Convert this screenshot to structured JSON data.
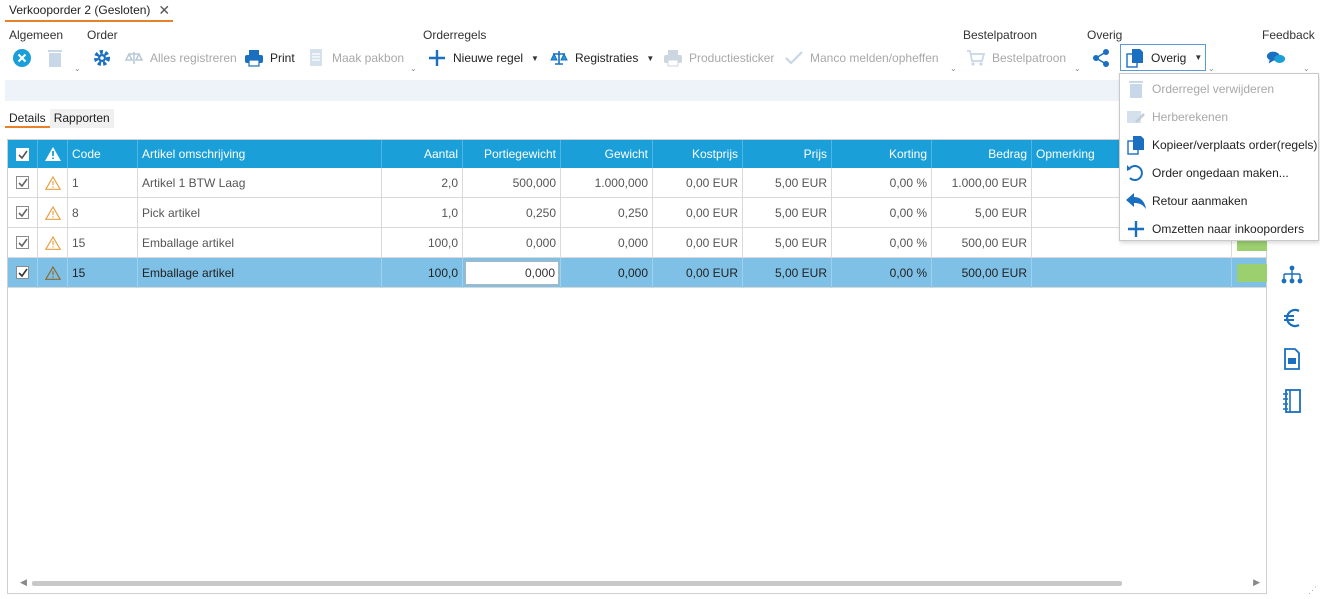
{
  "document_tab": {
    "title": "Verkooporder 2 (Gesloten)",
    "close_icon": "close-icon"
  },
  "ribbon": {
    "groups": {
      "algemeen": "Algemeen",
      "order": "Order",
      "orderregels": "Orderregels",
      "bestelpatroon": "Bestelpatroon",
      "overig": "Overig",
      "feedback": "Feedback"
    },
    "buttons": {
      "alles_registreren": "Alles registreren",
      "print": "Print",
      "maak_pakbon": "Maak pakbon",
      "nieuwe_regel": "Nieuwe regel",
      "registraties": "Registraties",
      "productiesticker": "Productiesticker",
      "manco": "Manco melden/opheffen",
      "bestelpatroon": "Bestelpatroon",
      "overig": "Overig"
    }
  },
  "subtabs": [
    {
      "label": "Details",
      "active": true
    },
    {
      "label": "Rapporten",
      "active": false
    }
  ],
  "grid": {
    "columns": [
      "Code",
      "Artikel omschrijving",
      "Aantal",
      "Portiegewicht",
      "Gewicht",
      "Kostprijs",
      "Prijs",
      "Korting",
      "Bedrag",
      "Opmerking"
    ],
    "rows": [
      {
        "code": "1",
        "omschrijving": "Artikel 1 BTW Laag",
        "aantal": "2,0",
        "portiegewicht": "500,000",
        "gewicht": "1.000,000",
        "kostprijs": "0,00 EUR",
        "prijs": "5,00 EUR",
        "korting": "0,00 %",
        "bedrag": "1.000,00 EUR",
        "opmerking": "",
        "selected": false
      },
      {
        "code": "8",
        "omschrijving": "Pick artikel",
        "aantal": "1,0",
        "portiegewicht": "0,250",
        "gewicht": "0,250",
        "kostprijs": "0,00 EUR",
        "prijs": "5,00 EUR",
        "korting": "0,00 %",
        "bedrag": "5,00 EUR",
        "opmerking": "",
        "selected": false
      },
      {
        "code": "15",
        "omschrijving": "Emballage artikel",
        "aantal": "100,0",
        "portiegewicht": "0,000",
        "gewicht": "0,000",
        "kostprijs": "0,00 EUR",
        "prijs": "5,00 EUR",
        "korting": "0,00 %",
        "bedrag": "500,00 EUR",
        "opmerking": "",
        "selected": false
      },
      {
        "code": "15",
        "omschrijving": "Emballage artikel",
        "aantal": "100,0",
        "portiegewicht": "0,000",
        "gewicht": "0,000",
        "kostprijs": "0,00 EUR",
        "prijs": "5,00 EUR",
        "korting": "0,00 %",
        "bedrag": "500,00 EUR",
        "opmerking": "",
        "selected": true
      }
    ]
  },
  "overig_menu": {
    "items": [
      {
        "label": "Orderregel verwijderen",
        "icon": "trash-icon",
        "disabled": true
      },
      {
        "label": "Herberekenen",
        "icon": "recalculate-icon",
        "disabled": true
      },
      {
        "label": "Kopieer/verplaats order(regels)",
        "icon": "copy-icon",
        "disabled": false
      },
      {
        "label": "Order ongedaan maken...",
        "icon": "undo-icon",
        "disabled": false
      },
      {
        "label": "Retour aanmaken",
        "icon": "return-icon",
        "disabled": false
      },
      {
        "label": "Omzetten naar inkooporders",
        "icon": "plus-icon",
        "disabled": false
      }
    ]
  },
  "side_icons": [
    "workflow-icon",
    "euro-icon",
    "document-icon",
    "notebook-icon"
  ],
  "colors": {
    "header_blue": "#1a9fd8",
    "icon_blue": "#1a6fc0",
    "selected_row": "#7ec0e6",
    "accent_orange": "#e8822a",
    "disabled_gray": "#a8a8a8"
  }
}
